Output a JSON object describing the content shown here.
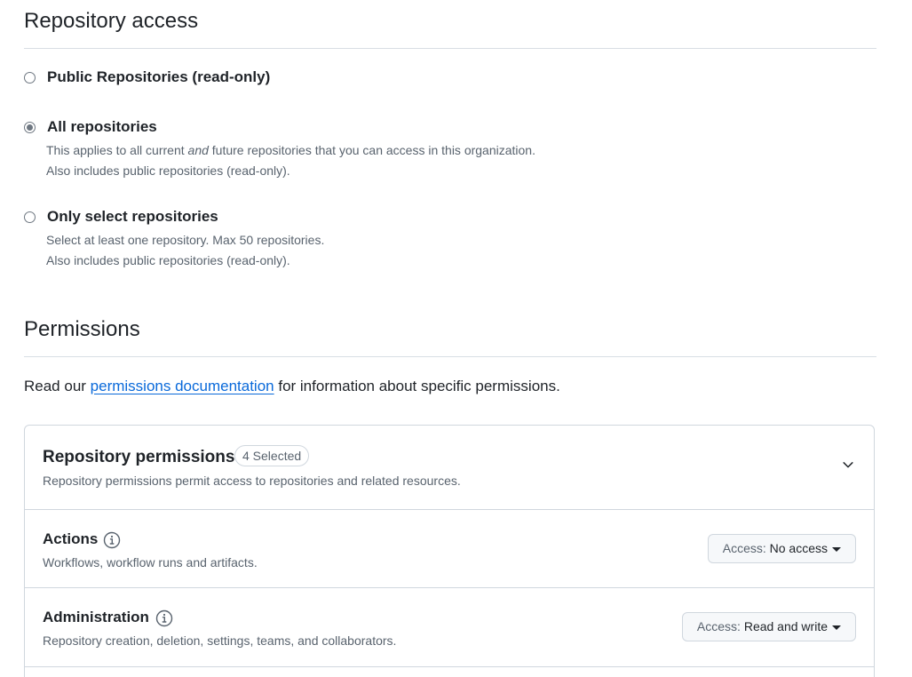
{
  "repository_access": {
    "heading": "Repository access",
    "options": [
      {
        "label": "Public Repositories (read-only)",
        "checked": false,
        "notes": []
      },
      {
        "label": "All repositories",
        "checked": true,
        "note_line1_pre": "This applies to all current ",
        "note_line1_em": "and",
        "note_line1_post": " future repositories that you can access in this organization.",
        "note_line2": "Also includes public repositories (read-only)."
      },
      {
        "label": "Only select repositories",
        "checked": false,
        "note_line1": "Select at least one repository. Max 50 repositories.",
        "note_line2": "Also includes public repositories (read-only)."
      }
    ]
  },
  "permissions": {
    "heading": "Permissions",
    "intro_pre": "Read our ",
    "intro_link": "permissions documentation",
    "intro_post": " for information about specific permissions.",
    "repository_permissions": {
      "title": "Repository permissions",
      "selected_badge": "4 Selected",
      "description": "Repository permissions permit access to repositories and related resources.",
      "rows": [
        {
          "name": "Actions",
          "description": "Workflows, workflow runs and artifacts.",
          "access_prefix": "Access: ",
          "access_value": "No access"
        },
        {
          "name": "Administration",
          "description": "Repository creation, deletion, settings, teams, and collaborators.",
          "access_prefix": "Access: ",
          "access_value": "Read and write"
        }
      ]
    }
  },
  "icons": {
    "info": "info-icon",
    "chevron": "chevron-down-icon",
    "caret": "triangle-down-icon"
  },
  "colors": {
    "link": "#0969da",
    "muted_text": "#59636e",
    "border": "#d0d7de",
    "button_bg": "#f6f8fa"
  }
}
